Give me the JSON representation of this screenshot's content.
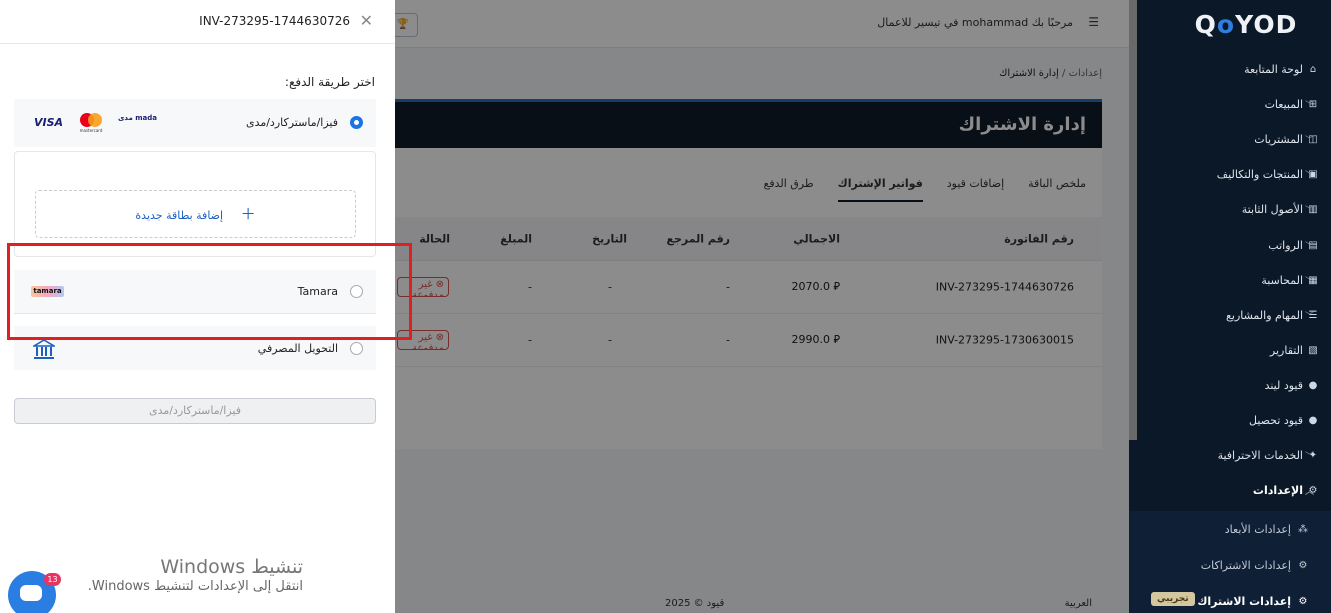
{
  "sidebar": {
    "logo_text": "QOYOD",
    "items": [
      {
        "label": "لوحة المتابعة",
        "icon": "dashboard-icon",
        "has_chevron": false
      },
      {
        "label": "المبيعات",
        "icon": "sales-icon",
        "has_chevron": true
      },
      {
        "label": "المشتريات",
        "icon": "purchases-icon",
        "has_chevron": true
      },
      {
        "label": "المنتجات والتكاليف",
        "icon": "products-icon",
        "has_chevron": true
      },
      {
        "label": "الأصول الثابتة",
        "icon": "assets-icon",
        "has_chevron": true
      },
      {
        "label": "الرواتب",
        "icon": "payroll-icon",
        "has_chevron": true
      },
      {
        "label": "المحاسبة",
        "icon": "accounting-icon",
        "has_chevron": true
      },
      {
        "label": "المهام والمشاريع",
        "icon": "tasks-icon",
        "has_chevron": true
      },
      {
        "label": "التقارير",
        "icon": "reports-icon",
        "has_chevron": false
      },
      {
        "label": "قيود ليند",
        "icon": "lend-icon",
        "has_chevron": false
      },
      {
        "label": "قيود تحصيل",
        "icon": "collection-icon",
        "has_chevron": false
      },
      {
        "label": "الخدمات الاحترافية",
        "icon": "services-icon",
        "has_chevron": true
      },
      {
        "label": "الإعدادات",
        "icon": "settings-icon",
        "has_chevron": true,
        "expanded": true
      }
    ],
    "sub_items": [
      {
        "label": "إعدادات الأبعاد",
        "icon": "dimensions-icon"
      },
      {
        "label": "إعدادات الاشتراكات",
        "icon": "gear-icon"
      },
      {
        "label": "إعدادات الاشتراك",
        "icon": "gear-icon",
        "badge": "تجريبي"
      }
    ]
  },
  "topbar": {
    "welcome": "مرحبًا بك mohammad في تيسير للاعمال"
  },
  "breadcrumb": {
    "parent": "إعدادات",
    "separator": "/",
    "current": "إدارة الاشتراك"
  },
  "page": {
    "title": "إدارة الاشتراك",
    "tabs": [
      "ملخص الباقة",
      "إضافات قيود",
      "فواتير الإشتراك",
      "طرق الدفع"
    ],
    "active_tab": 2
  },
  "table": {
    "headers": {
      "invoice": "رقم الفاتورة",
      "total": "الاجمالي",
      "ref": "رقم المرجع",
      "date": "التاريخ",
      "amount": "المبلغ",
      "status": "الحالة"
    },
    "rows": [
      {
        "invoice": "INV-273295-1744630726",
        "total": "2070.0 ⃁",
        "ref": "-",
        "date": "-",
        "amount": "-",
        "status": "غير مدفوعة"
      },
      {
        "invoice": "INV-273295-1730630015",
        "total": "2990.0 ⃁",
        "ref": "-",
        "date": "-",
        "amount": "-",
        "status": "غير مدفوعة"
      }
    ]
  },
  "footer": {
    "copyright": "قيود © 2025",
    "language": "العربية"
  },
  "drawer": {
    "title": "INV-273295-1744630726",
    "choose_label": "اختر طريقة الدفع:",
    "options": {
      "card": {
        "label": "فيزا/ماستركارد/مدى",
        "selected": true,
        "logos": {
          "visa": "VISA",
          "mastercard": "mastercard",
          "mada": "مدى mada"
        }
      },
      "tamara": {
        "label": "Tamara",
        "selected": false,
        "logo": "tamara"
      },
      "bank": {
        "label": "التحويل المصرفي",
        "selected": false
      }
    },
    "add_card_label": "إضافة بطاقة جديدة",
    "submit_label": "فيزا/ماستركارد/مدى"
  },
  "watermark": {
    "line1": "تنشيط Windows",
    "line2": "انتقل إلى الإعدادات لتنشيط Windows."
  },
  "chat": {
    "badge": "13"
  },
  "colors": {
    "sidebar_bg": "#0b1827",
    "accent": "#1b73e8",
    "highlight": "#e02020",
    "card_header": "#111c2b"
  }
}
